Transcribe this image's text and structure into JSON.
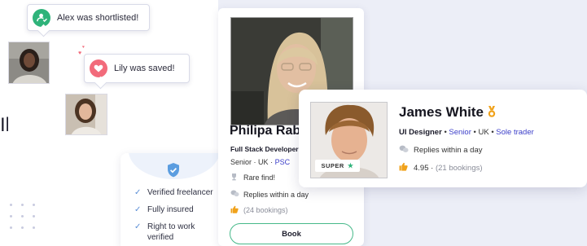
{
  "background_left_text": "Il",
  "toasts": {
    "shortlisted": {
      "text": "Alex was shortlisted!",
      "icon": "user-check-icon",
      "color": "#2fb37a"
    },
    "saved": {
      "text": "Lily was saved!",
      "icon": "heart-icon",
      "color": "#f26b7b"
    }
  },
  "verification": {
    "icon": "shield-check-icon",
    "items": [
      "Verified freelancer",
      "Fully insured",
      "Right to work verified"
    ]
  },
  "philipa": {
    "name": "Philipa Rabb",
    "role": "Full Stack Developer",
    "level": "Senior",
    "location": "UK",
    "status": "PSC",
    "line1": "Rare find!",
    "line2": "Replies within a day",
    "bookings": "(24 bookings)",
    "book_label": "Book"
  },
  "james": {
    "name": "James White",
    "role": "UI Designer",
    "level": "Senior",
    "location": "UK",
    "status": "Sole trader",
    "badge": "SUPER",
    "replies": "Replies within a day",
    "rating": "4.95",
    "bookings": "(21 bookings)"
  },
  "colors": {
    "accent": "#3b3ec9",
    "green": "#47b98a",
    "gold": "#f0a21b"
  }
}
